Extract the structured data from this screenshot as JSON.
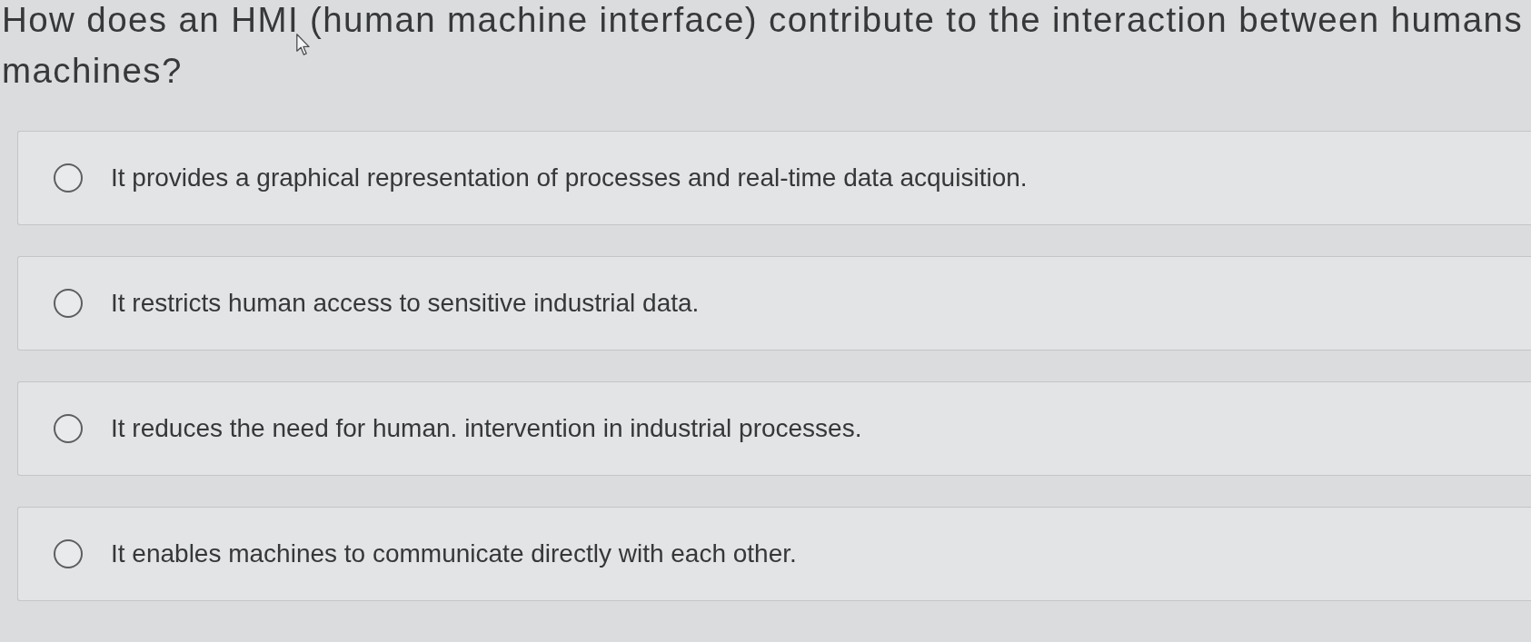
{
  "question": {
    "lines": [
      "How does an HMI (human machine interface) contribute to the interaction between humans",
      "machines?"
    ]
  },
  "options": [
    {
      "label": "It provides a graphical representation of processes and real-time data acquisition.",
      "selected": false
    },
    {
      "label": "It restricts human access to sensitive industrial data.",
      "selected": false
    },
    {
      "label": "It reduces the need for human. intervention in industrial processes.",
      "selected": false
    },
    {
      "label": "It enables machines to communicate directly with each other.",
      "selected": false
    }
  ]
}
